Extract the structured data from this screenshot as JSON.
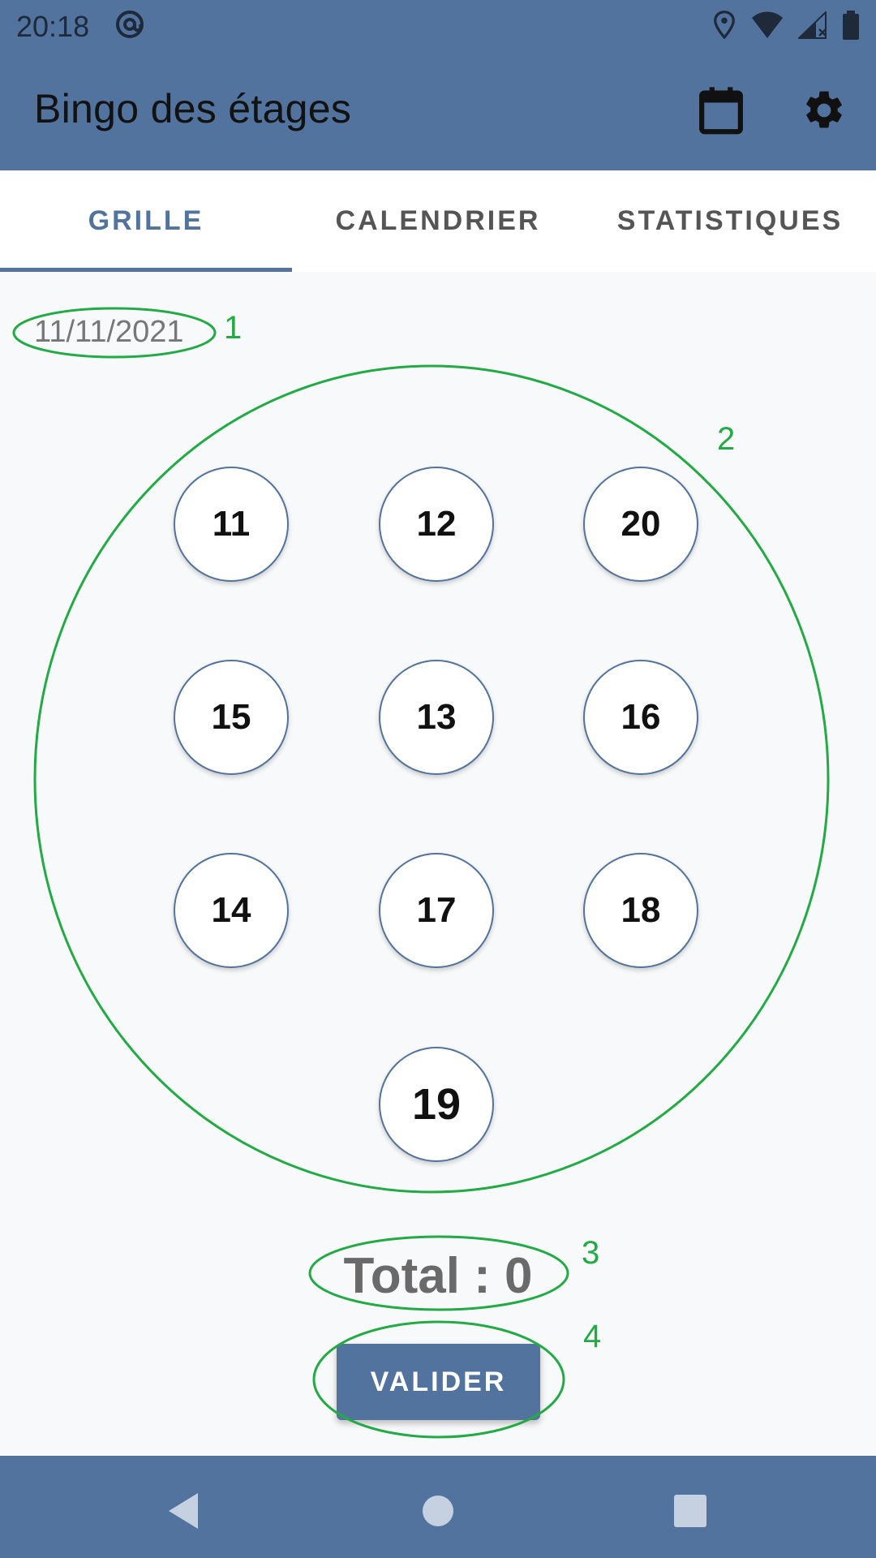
{
  "status_bar": {
    "time": "20:18",
    "icons": [
      "at-sign-icon",
      "location-icon",
      "wifi-icon",
      "signal-icon",
      "battery-icon"
    ]
  },
  "app_bar": {
    "title": "Bingo des étages",
    "actions": [
      "calendar-icon",
      "settings-gear-icon"
    ]
  },
  "tabs": [
    {
      "label": "GRILLE",
      "active": true
    },
    {
      "label": "CALENDRIER",
      "active": false
    },
    {
      "label": "STATISTIQUES",
      "active": false
    }
  ],
  "date": "11/11/2021",
  "grid": {
    "rows": [
      [
        "11",
        "12",
        "20"
      ],
      [
        "15",
        "13",
        "16"
      ],
      [
        "14",
        "17",
        "18"
      ],
      [
        "19"
      ]
    ]
  },
  "total": "Total : 0",
  "validate_label": "VALIDER",
  "annotations": [
    "1",
    "2",
    "3",
    "4"
  ],
  "navigation": [
    "back-icon",
    "home-icon",
    "recents-icon"
  ],
  "colors": {
    "primary": "#52739d",
    "annotation": "#22aa44",
    "background": "#f8f9fa"
  }
}
